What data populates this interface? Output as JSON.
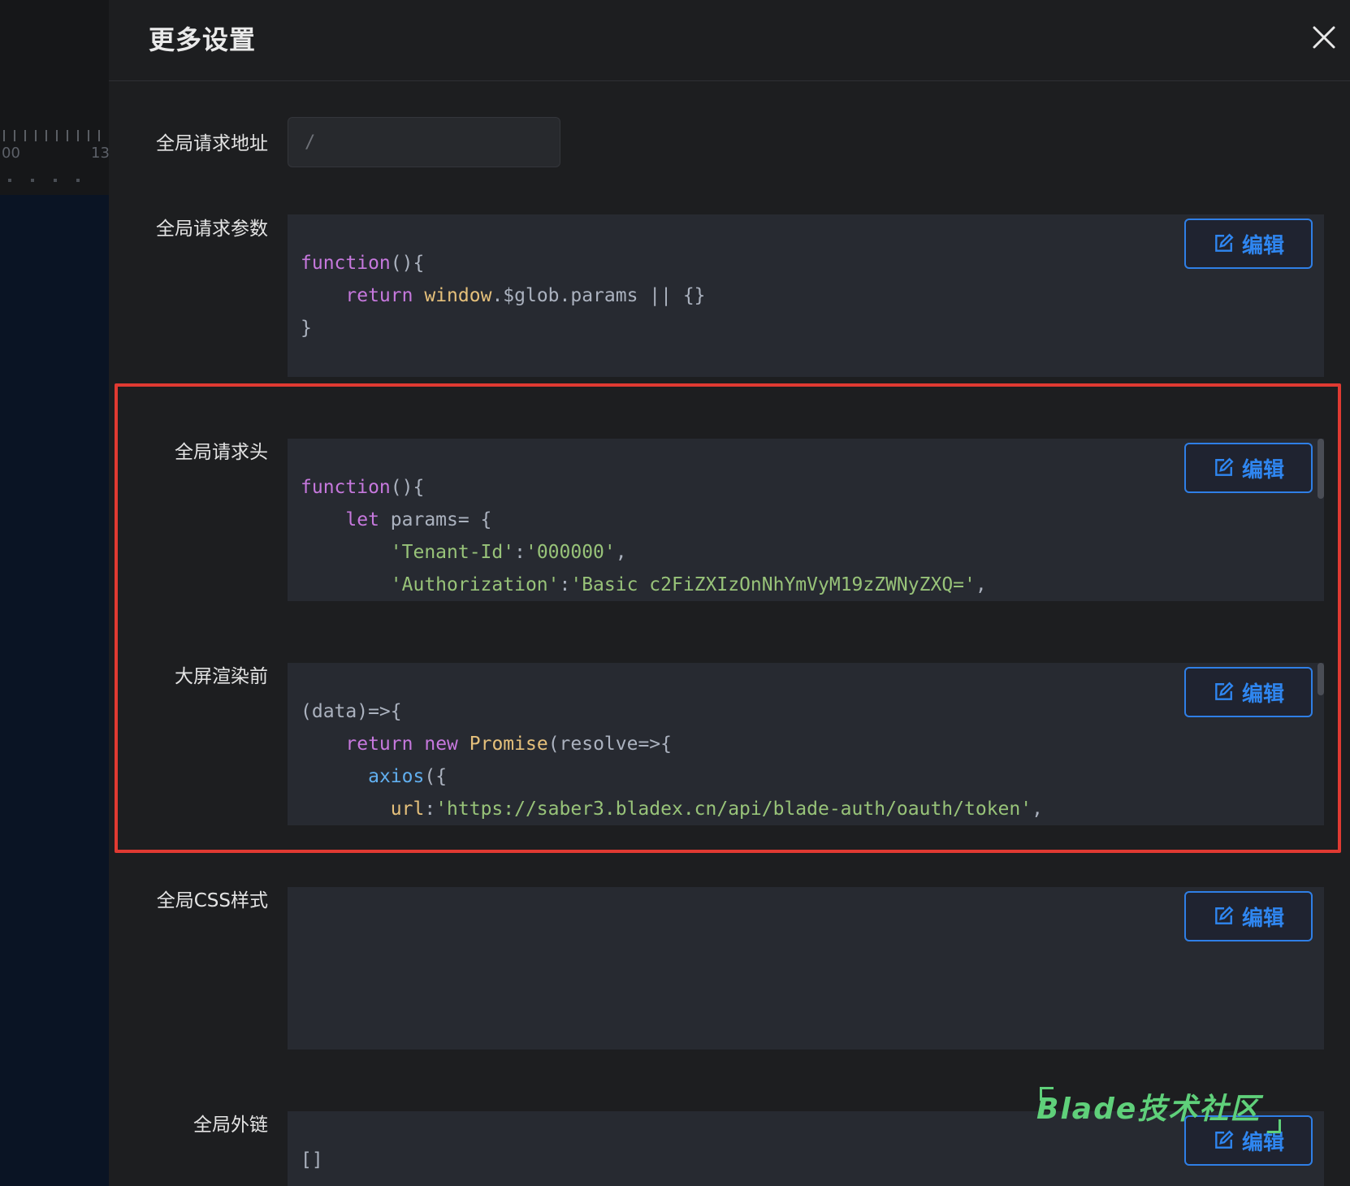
{
  "drawer": {
    "title": "更多设置",
    "close_icon": "close-icon"
  },
  "background": {
    "ruler_labels": [
      "00",
      "13"
    ]
  },
  "fields": {
    "global_request_url": {
      "label": "全局请求地址",
      "value": "/"
    },
    "global_request_params": {
      "label": "全局请求参数",
      "edit_label": "编辑",
      "code_lines": [
        "function(){",
        "    return window.$glob.params || {}",
        "}"
      ]
    },
    "global_request_headers": {
      "label": "全局请求头",
      "edit_label": "编辑",
      "code_lines": [
        "function(){",
        "    let params= {",
        "        'Tenant-Id':'000000',",
        "        'Authorization':'Basic c2FiZXIzOnNhYmVyM19zZWNyZXQ=',"
      ]
    },
    "before_render": {
      "label": "大屏渲染前",
      "edit_label": "编辑",
      "code_lines": [
        "(data)=>{",
        "    return new Promise(resolve=>{",
        "      axios({",
        "        url:'https://saber3.bladex.cn/api/blade-auth/oauth/token',"
      ]
    },
    "global_css": {
      "label": "全局CSS样式",
      "edit_label": "编辑",
      "code_lines": []
    },
    "global_links": {
      "label": "全局外链",
      "edit_label": "编辑",
      "code_lines": [
        "[]"
      ]
    }
  },
  "watermark": "Blade技术社区",
  "colors": {
    "accent": "#2f86f0",
    "highlight": "#e03a32",
    "watermark": "#5fd07a"
  }
}
